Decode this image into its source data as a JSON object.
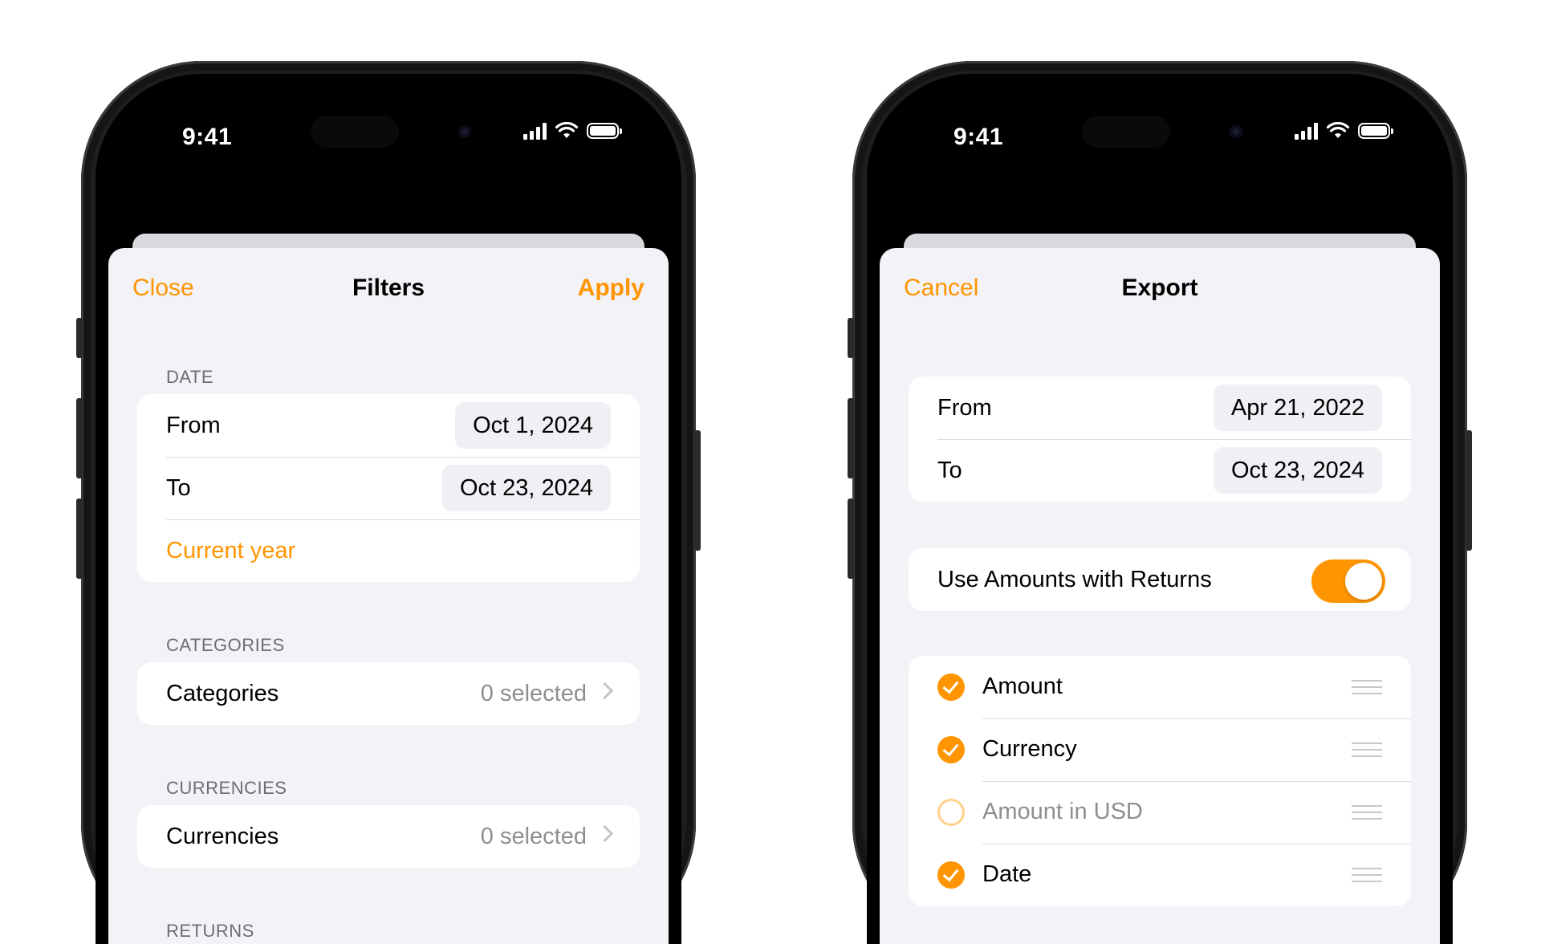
{
  "status": {
    "time": "9:41"
  },
  "colors": {
    "accent": "#ff9500",
    "background": "#f2f2f7"
  },
  "filters": {
    "nav": {
      "left": "Close",
      "title": "Filters",
      "right": "Apply"
    },
    "date_header": "DATE",
    "from_label": "From",
    "from_value": "Oct 1, 2024",
    "to_label": "To",
    "to_value": "Oct 23, 2024",
    "preset": "Current year",
    "categories_header": "CATEGORIES",
    "categories_label": "Categories",
    "categories_value": "0 selected",
    "currencies_header": "CURRENCIES",
    "currencies_label": "Currencies",
    "currencies_value": "0 selected",
    "returns_header": "RETURNS"
  },
  "export": {
    "nav": {
      "left": "Cancel",
      "title": "Export"
    },
    "from_label": "From",
    "from_value": "Apr 21, 2022",
    "to_label": "To",
    "to_value": "Oct 23, 2024",
    "toggle_label": "Use Amounts with Returns",
    "toggle_on": true,
    "fields": [
      {
        "label": "Amount",
        "checked": true
      },
      {
        "label": "Currency",
        "checked": true
      },
      {
        "label": "Amount in USD",
        "checked": false
      },
      {
        "label": "Date",
        "checked": true
      }
    ]
  }
}
